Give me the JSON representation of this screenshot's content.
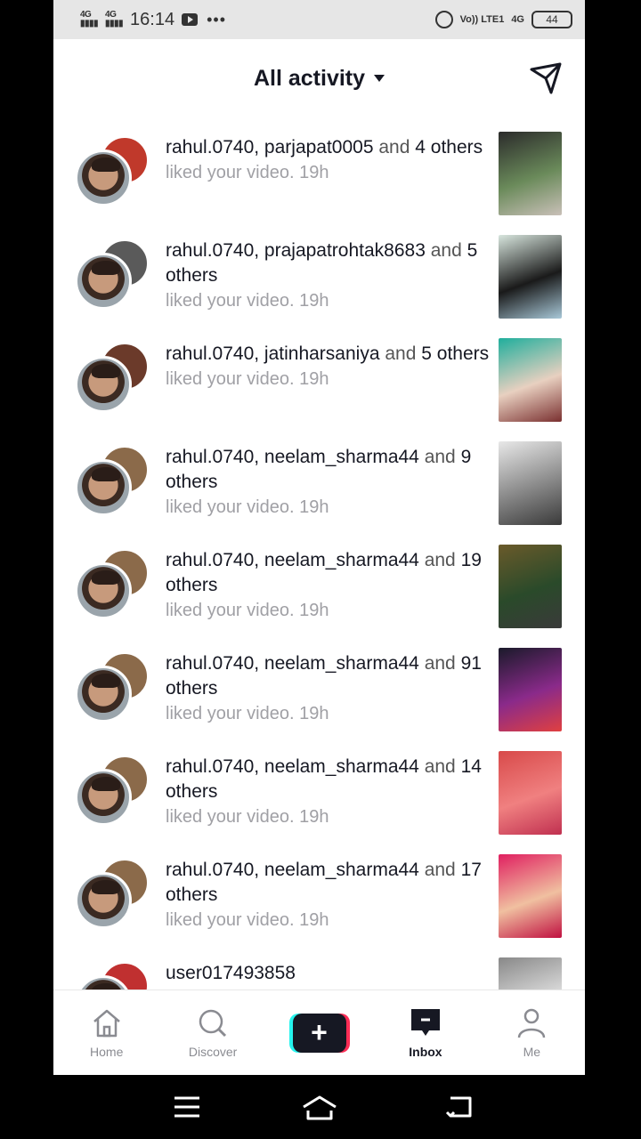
{
  "status_bar": {
    "signal1": "4G",
    "signal2": "4G",
    "time": "16:14",
    "dots": "•••",
    "volte": "Vo)) LTE1",
    "net": "4G",
    "battery": "44"
  },
  "header": {
    "title": "All activity",
    "send_icon": "paper-plane-icon"
  },
  "activities": [
    {
      "user1": "rahul.0740",
      "user2": "parjapat0005",
      "and_text": "and",
      "others": "4 others",
      "action": "liked your video.",
      "time": "19h",
      "back_color": "#c0392b",
      "thumb_colors": [
        "#2b2b2b",
        "#6a8a5a",
        "#c9c0b8"
      ]
    },
    {
      "user1": "rahul.0740",
      "user2": "prajapatrohtak8683",
      "and_text": "and",
      "others": "5 others",
      "action": "liked your video.",
      "time": "19h",
      "back_color": "#5a5a5a",
      "thumb_colors": [
        "#d8e6de",
        "#1a1a1a",
        "#a8c8d8"
      ]
    },
    {
      "user1": "rahul.0740",
      "user2": "jatinharsaniya",
      "and_text": "and",
      "others": "5 others",
      "action": "liked your video.",
      "time": "19h",
      "back_color": "#6b3a2a",
      "thumb_colors": [
        "#1fae9c",
        "#e8d0c0",
        "#7a3030"
      ]
    },
    {
      "user1": "rahul.0740",
      "user2": "neelam_sharma44",
      "and_text": "and",
      "others": "9 others",
      "action": "liked your video.",
      "time": "19h",
      "back_color": "#8b6a4a",
      "thumb_colors": [
        "#e8e8e8",
        "#888888",
        "#3a3a3a"
      ]
    },
    {
      "user1": "rahul.0740",
      "user2": "neelam_sharma44",
      "and_text": "and",
      "others": "19 others",
      "action": "liked your video.",
      "time": "19h",
      "back_color": "#8b6a4a",
      "thumb_colors": [
        "#6a5a2a",
        "#2a4a2a",
        "#3a3a3a"
      ]
    },
    {
      "user1": "rahul.0740",
      "user2": "neelam_sharma44",
      "and_text": "and",
      "others": "91 others",
      "action": "liked your video.",
      "time": "19h",
      "back_color": "#8b6a4a",
      "thumb_colors": [
        "#1a1a2a",
        "#8a2a8a",
        "#e04040"
      ]
    },
    {
      "user1": "rahul.0740",
      "user2": "neelam_sharma44",
      "and_text": "and",
      "others": "14 others",
      "action": "liked your video.",
      "time": "19h",
      "back_color": "#8b6a4a",
      "thumb_colors": [
        "#d84a4a",
        "#f08080",
        "#c03050"
      ]
    },
    {
      "user1": "rahul.0740",
      "user2": "neelam_sharma44",
      "and_text": "and",
      "others": "17 others",
      "action": "liked your video.",
      "time": "19h",
      "back_color": "#8b6a4a",
      "thumb_colors": [
        "#e02060",
        "#f0c0a0",
        "#c01040"
      ]
    },
    {
      "user1": "user017493858",
      "user2": "",
      "and_text": "",
      "others": "",
      "action": "",
      "time": "",
      "back_color": "#c03030",
      "thumb_colors": [
        "#888888",
        "#dddddd",
        "#444444"
      ]
    }
  ],
  "bottom_nav": [
    {
      "label": "Home",
      "icon": "home-icon",
      "active": false
    },
    {
      "label": "Discover",
      "icon": "search-icon",
      "active": false
    },
    {
      "label": "",
      "icon": "plus-icon",
      "active": false
    },
    {
      "label": "Inbox",
      "icon": "inbox-icon",
      "active": true
    },
    {
      "label": "Me",
      "icon": "person-icon",
      "active": false
    }
  ],
  "system_nav": [
    "menu-icon",
    "home-outline-icon",
    "back-icon"
  ]
}
